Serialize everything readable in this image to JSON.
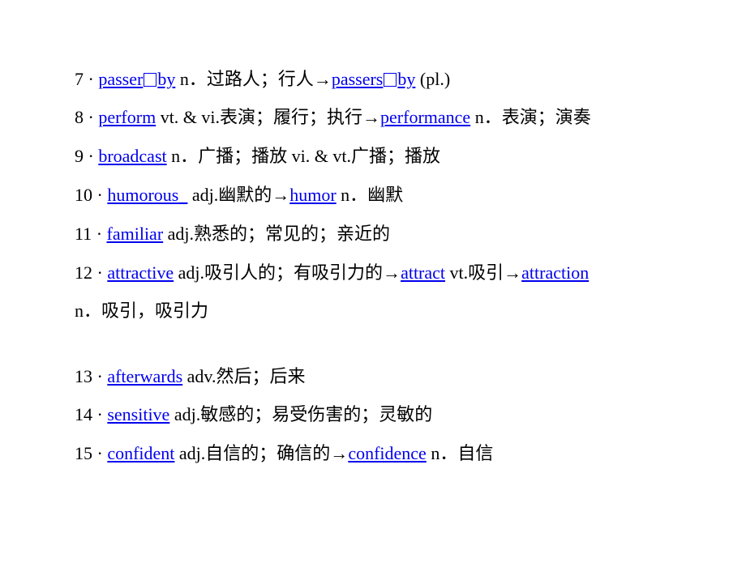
{
  "entries": [
    {
      "num": "7",
      "word_a": "passer",
      "word_b": "by",
      "def1": " n．过路人；行人→",
      "word2_a": "passers",
      "word2_b": "by",
      "def2": " (pl.)"
    },
    {
      "num": "8",
      "word": "perform",
      "def1": " vt. & vi.表演；履行；执行→",
      "word2": "performance",
      "def2": " n．表演；演奏"
    },
    {
      "num": "9",
      "word": "broadcast",
      "def1": " n．广播；播放  vi. & vt.广播；播放"
    },
    {
      "num": "10",
      "word": "humorous_",
      "def1": " adj.幽默的→",
      "word2": "humor",
      "def2": " n．幽默"
    },
    {
      "num": "11",
      "word": "familiar",
      "def1": " adj.熟悉的；常见的；亲近的"
    },
    {
      "num": "12",
      "word": "attractive",
      "def1": " adj.吸引人的；有吸引力的→",
      "word2": "attract",
      "def2": " vt.吸引→",
      "word3": "attraction",
      "cont": "n．吸引，吸引力"
    },
    {
      "num": "13",
      "word": "afterwards",
      "def1": " adv.然后；后来"
    },
    {
      "num": "14",
      "word": "sensitive",
      "def1": " adj.敏感的；易受伤害的；灵敏的"
    },
    {
      "num": "15",
      "word": "confident",
      "def1": " adj.自信的；确信的→",
      "word2": "confidence",
      "def2": " n．自信"
    }
  ],
  "separator": "·",
  "colors": {
    "link": "#0000ee",
    "text": "#000000",
    "background": "#ffffff"
  }
}
